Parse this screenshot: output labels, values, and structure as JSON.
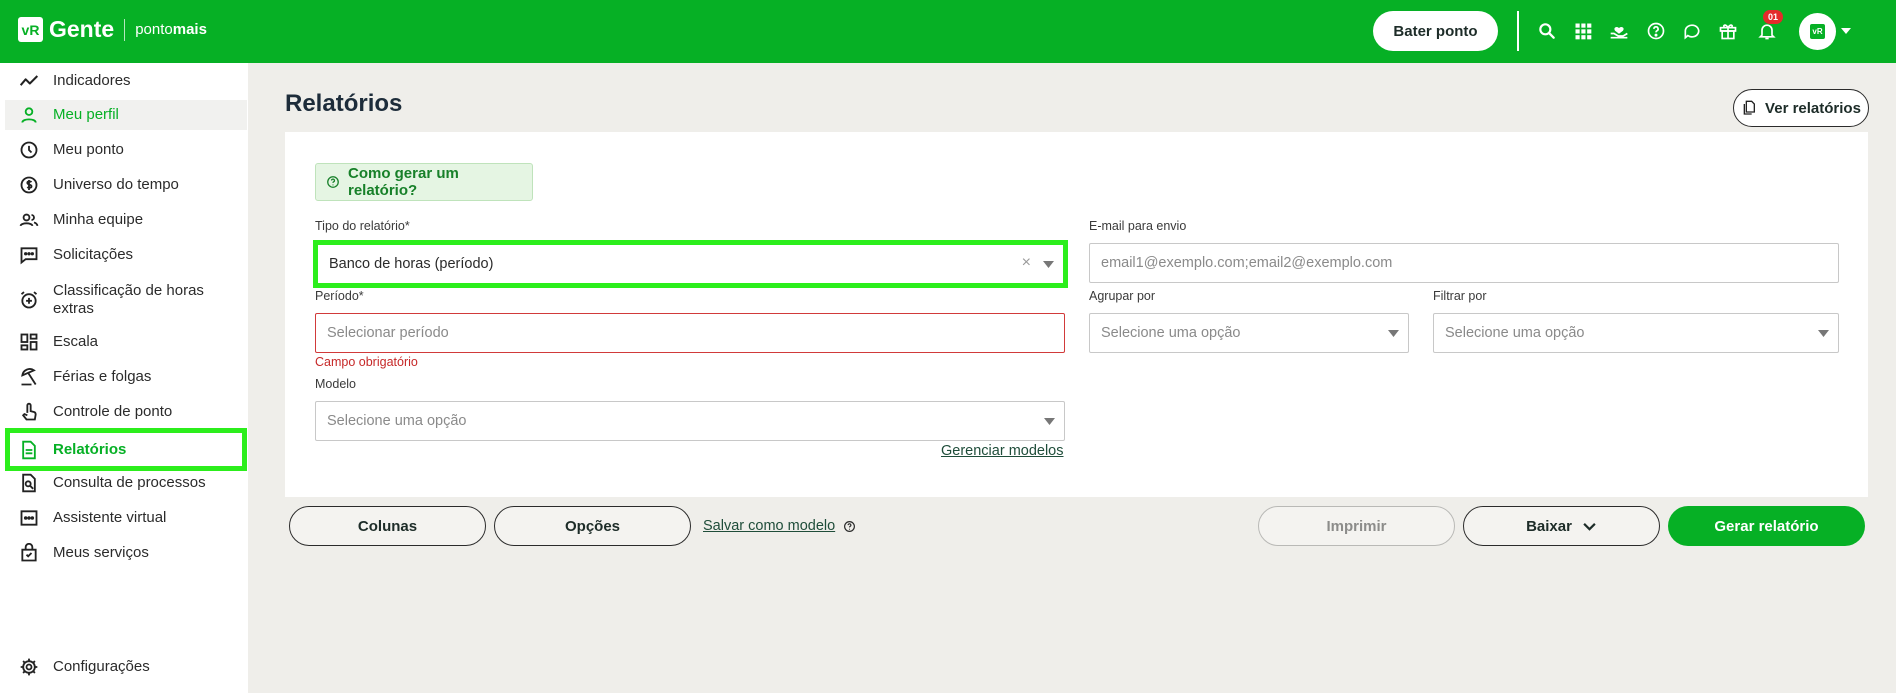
{
  "brand": {
    "logo_mark": "vR",
    "name": "Gente",
    "sub_prefix": "ponto",
    "sub_bold": "mais"
  },
  "header": {
    "bater_ponto": "Bater ponto",
    "notification_count": "01",
    "avatar_mark": "vR",
    "icons": [
      "search-icon",
      "apps-grid-icon",
      "heart-hand-icon",
      "help-icon",
      "chat-icon",
      "gift-icon",
      "bell-icon"
    ]
  },
  "sidebar": {
    "items": [
      {
        "label": "Indicadores",
        "icon": "trend-line-icon"
      },
      {
        "label": "Meu perfil",
        "icon": "person-icon"
      },
      {
        "label": "Meu ponto",
        "icon": "clock-icon"
      },
      {
        "label": "Universo do tempo",
        "icon": "coin-icon"
      },
      {
        "label": "Minha equipe",
        "icon": "team-icon"
      },
      {
        "label": "Solicitações",
        "icon": "message-dots-icon"
      },
      {
        "label": "Classificação de horas extras",
        "icon": "alarm-plus-icon"
      },
      {
        "label": "Escala",
        "icon": "dashboard-icon"
      },
      {
        "label": "Férias e folgas",
        "icon": "beach-umbrella-icon"
      },
      {
        "label": "Controle de ponto",
        "icon": "touch-hand-icon"
      },
      {
        "label": "Relatórios",
        "icon": "document-icon"
      },
      {
        "label": "Consulta de processos",
        "icon": "file-search-icon"
      },
      {
        "label": "Assistente virtual",
        "icon": "assistant-icon"
      },
      {
        "label": "Meus serviços",
        "icon": "bag-icon"
      }
    ],
    "settings_label": "Configurações"
  },
  "page": {
    "title": "Relatórios",
    "ver_relatorios": "Ver relatórios",
    "help_link": "Como gerar um relatório?"
  },
  "form": {
    "tipo_label": "Tipo do relatório*",
    "tipo_value": "Banco de horas (período)",
    "email_label": "E-mail para envio",
    "email_placeholder": "email1@exemplo.com;email2@exemplo.com",
    "periodo_label": "Período*",
    "periodo_placeholder": "Selecionar período",
    "periodo_error": "Campo obrigatório",
    "agrupar_label": "Agrupar por",
    "agrupar_placeholder": "Selecione uma opção",
    "filtrar_label": "Filtrar por",
    "filtrar_placeholder": "Selecione uma opção",
    "modelo_label": "Modelo",
    "modelo_placeholder": "Selecione uma opção",
    "gerenciar_modelos": "Gerenciar modelos"
  },
  "actions": {
    "colunas": "Colunas",
    "opcoes": "Opções",
    "salvar_modelo": "Salvar como modelo",
    "imprimir": "Imprimir",
    "baixar": "Baixar",
    "gerar": "Gerar relatório"
  },
  "colors": {
    "brand_green": "#06b025",
    "highlight": "#2cee1c",
    "error": "#d13a3a",
    "background": "#efeeea"
  }
}
